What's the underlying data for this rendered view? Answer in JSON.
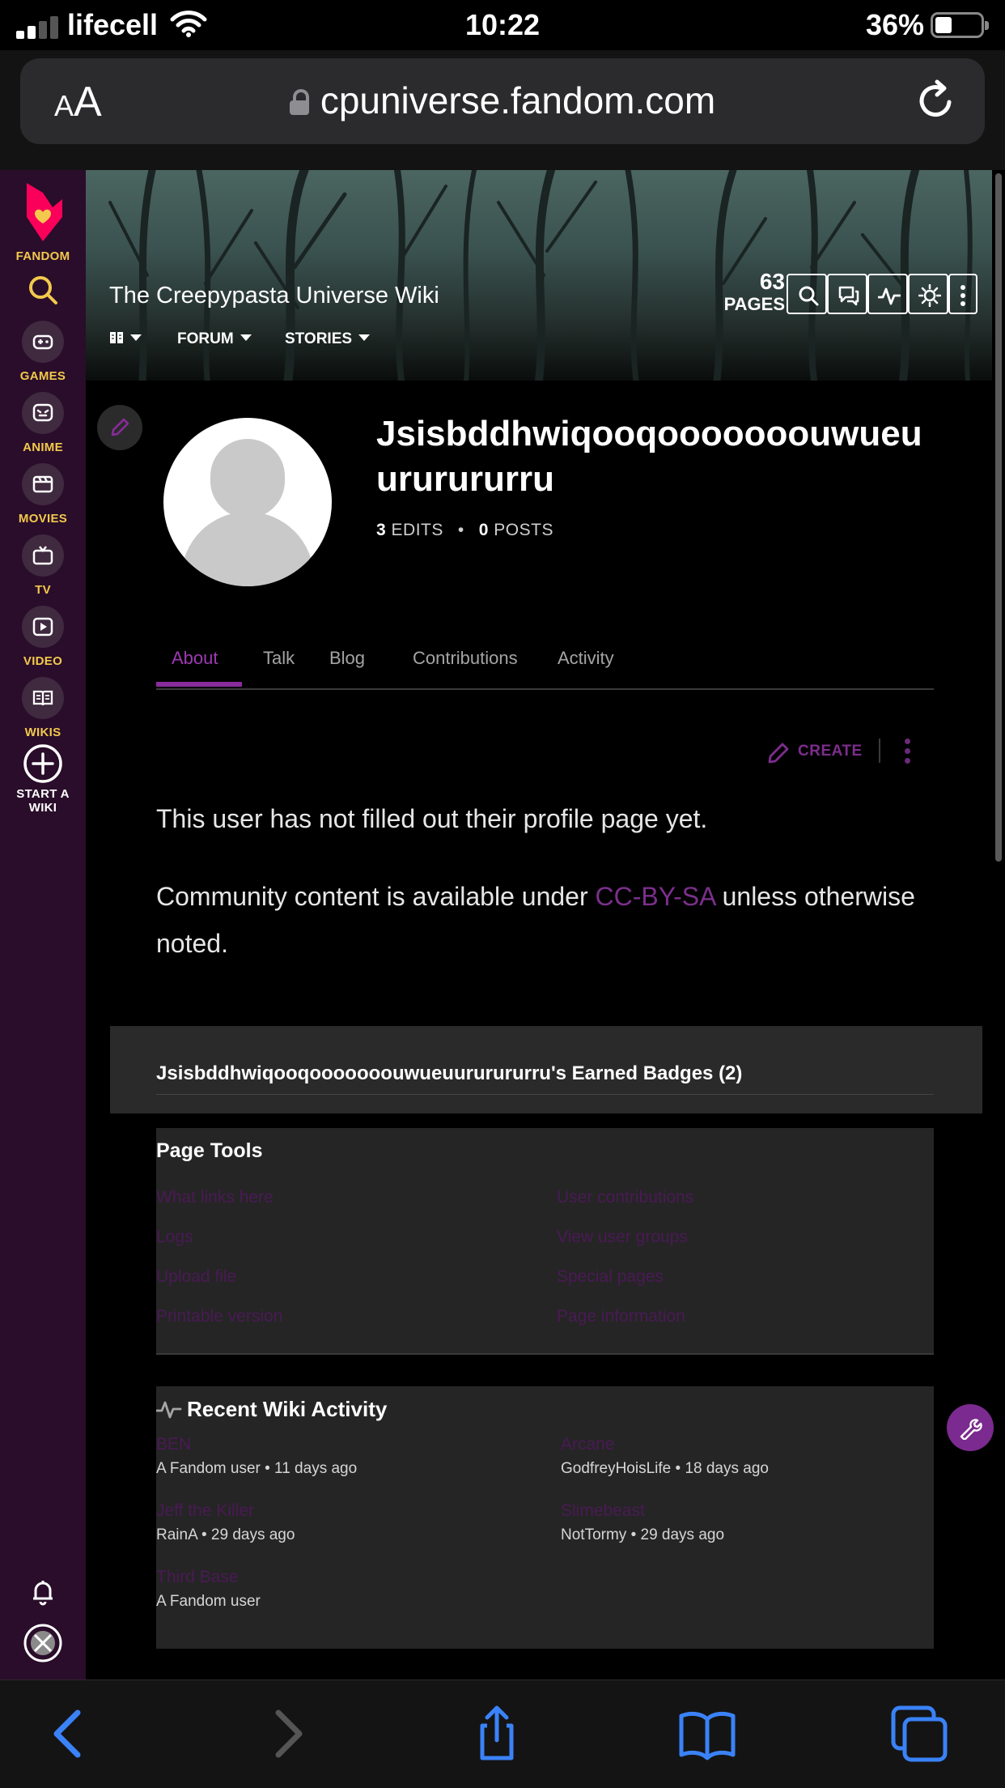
{
  "status": {
    "carrier": "lifecell",
    "time": "10:22",
    "battery": "36%"
  },
  "browser": {
    "text_size_small": "A",
    "text_size_large": "A",
    "url": "cpuniverse.fandom.com"
  },
  "fandom_nav": {
    "logo_label": "FANDOM",
    "items": [
      {
        "label": "GAMES",
        "icon": "gamepad-icon"
      },
      {
        "label": "ANIME",
        "icon": "anime-icon"
      },
      {
        "label": "MOVIES",
        "icon": "movie-icon"
      },
      {
        "label": "TV",
        "icon": "tv-icon"
      },
      {
        "label": "VIDEO",
        "icon": "video-icon"
      },
      {
        "label": "WIKIS",
        "icon": "book-icon"
      }
    ],
    "start_wiki": "START A\nWIKI"
  },
  "wiki": {
    "title": "The Creepypasta Universe Wiki",
    "nav": {
      "forum": "FORUM",
      "stories": "STORIES"
    },
    "pages_count": "63",
    "pages_label": "PAGES"
  },
  "profile": {
    "username": "Jsisbddhwiqooqooooooouwueuururururru",
    "edits_count": "3",
    "edits_label": "EDITS",
    "posts_count": "0",
    "posts_label": "POSTS",
    "tabs": [
      "About",
      "Talk",
      "Blog",
      "Contributions",
      "Activity"
    ],
    "active_tab": "About"
  },
  "content": {
    "create_label": "CREATE",
    "empty_message": "This user has not filled out their profile page yet.",
    "license_prefix": "Community content is available under ",
    "license_link": "CC-BY-SA",
    "license_suffix": " unless otherwise noted."
  },
  "badges": {
    "title": "Jsisbddhwiqooqooooooouwueuururururru's Earned Badges (2)"
  },
  "page_tools": {
    "title": "Page Tools",
    "links": [
      "What links here",
      "User contributions",
      "Logs",
      "View user groups",
      "Upload file",
      "Special pages",
      "Printable version",
      "Page information"
    ]
  },
  "recent_activity": {
    "title": "Recent Wiki Activity",
    "items": [
      {
        "title": "BEN",
        "meta": "A Fandom user • 11 days ago"
      },
      {
        "title": "Arcane",
        "meta": "GodfreyHoisLife • 18 days ago"
      },
      {
        "title": "Jeff the Killer",
        "meta": "RainA • 29 days ago"
      },
      {
        "title": "Slimebeast",
        "meta": "NotTormy • 29 days ago"
      },
      {
        "title": "Third Base",
        "meta": "A Fandom user"
      }
    ]
  },
  "colors": {
    "accent": "#8a2b9c",
    "nav_bg": "#2a0d2a",
    "nav_label": "#f2c94c",
    "ios_blue": "#3a82f7"
  }
}
